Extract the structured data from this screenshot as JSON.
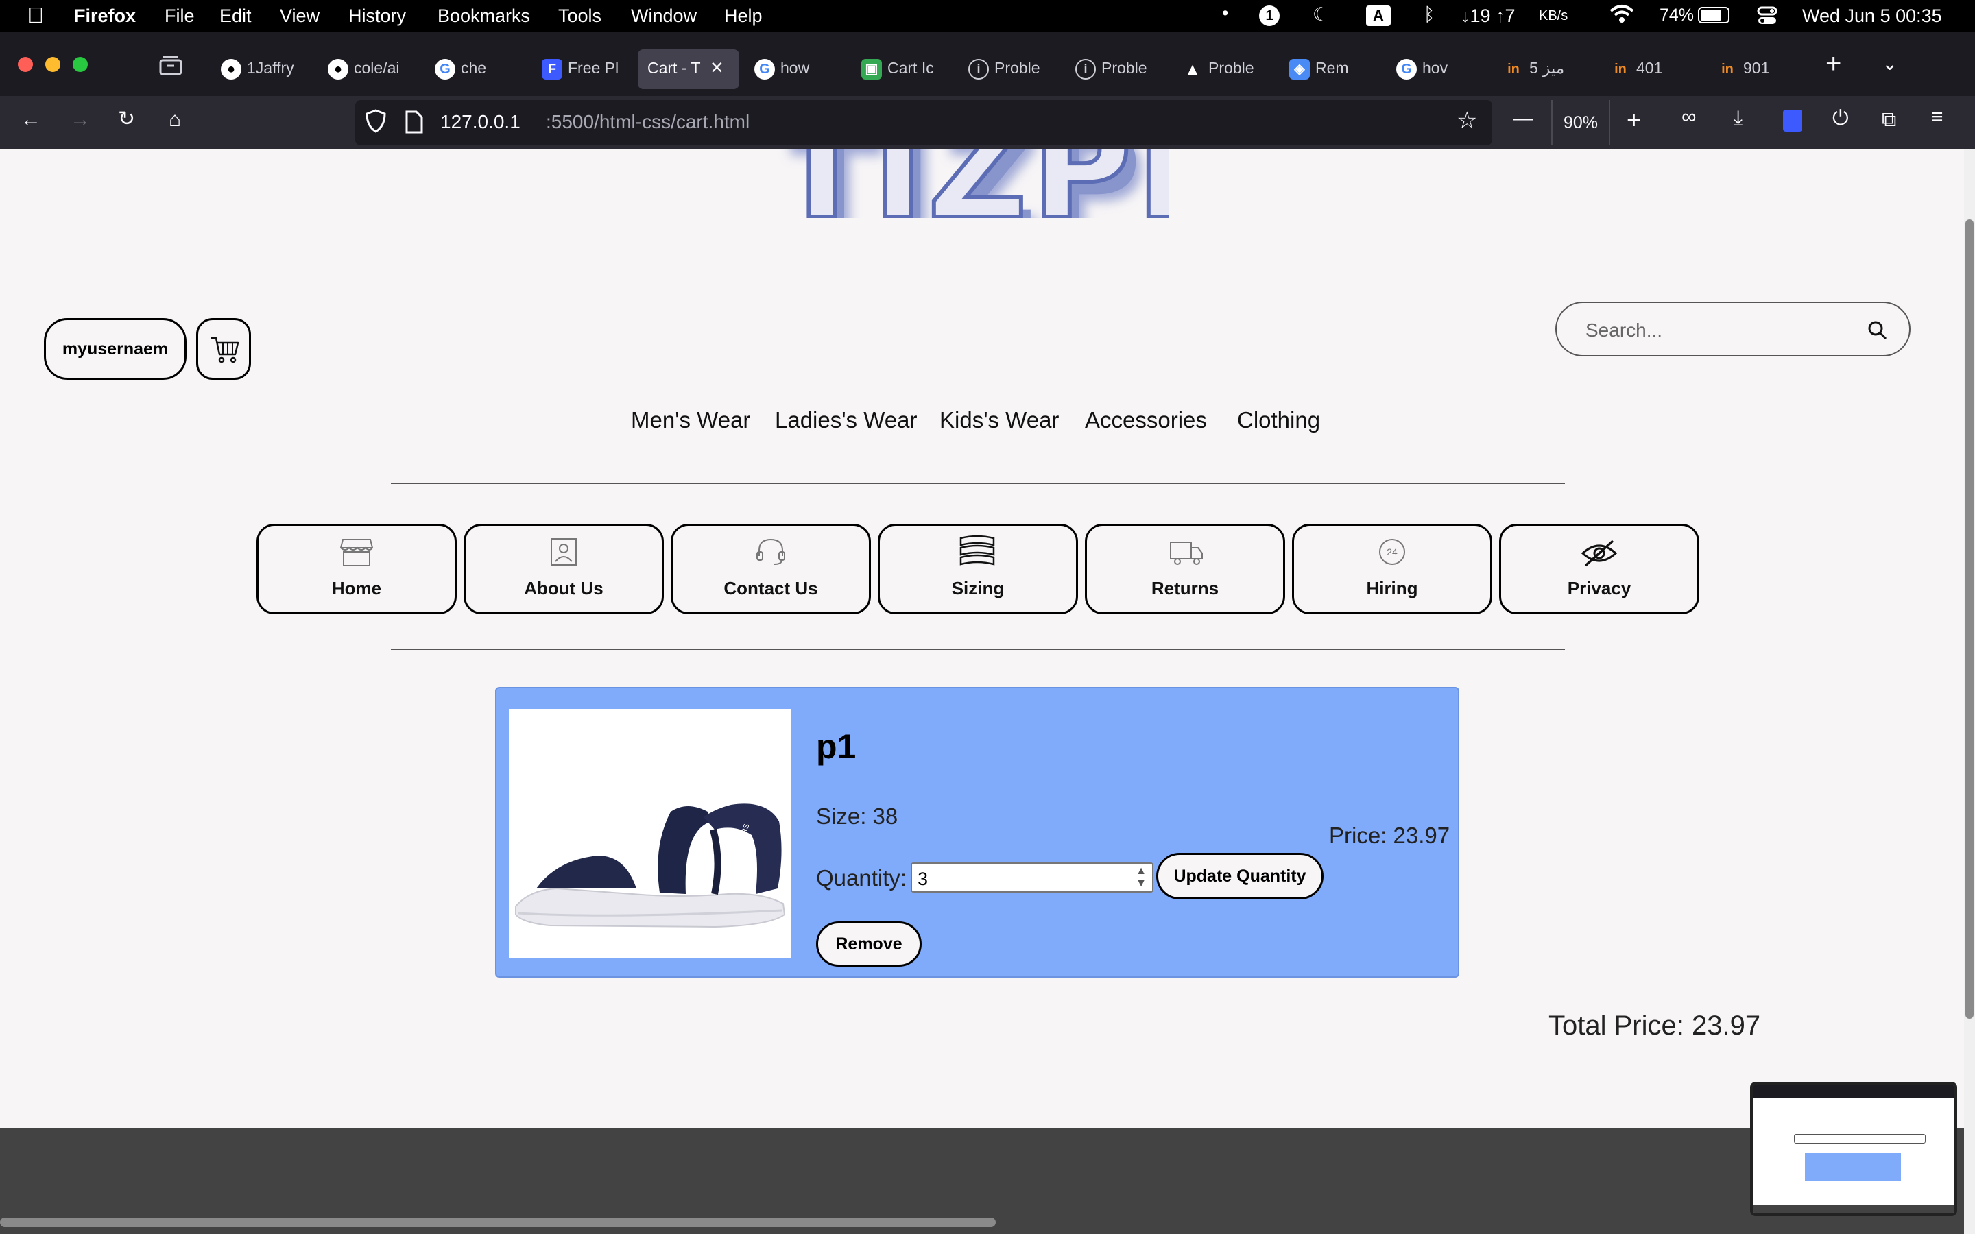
{
  "menubar": {
    "app": "Firefox",
    "items": [
      "File",
      "Edit",
      "View",
      "History",
      "Bookmarks",
      "Tools",
      "Window",
      "Help"
    ],
    "status": {
      "badge": "1",
      "input_source": "A",
      "network": "↓19 ↑7",
      "network_unit": "KB/s",
      "battery": "74%",
      "datetime": "Wed Jun 5  00:35"
    }
  },
  "tabs": [
    {
      "label": "1Jaffry",
      "icon": "github-icon"
    },
    {
      "label": "cole/ai",
      "icon": "github-icon"
    },
    {
      "label": "che",
      "icon": "google-icon"
    },
    {
      "label": "Free Pl",
      "icon": "f-icon"
    },
    {
      "label": "Cart - T",
      "icon": "",
      "active": true
    },
    {
      "label": "how",
      "icon": "google-icon"
    },
    {
      "label": "Cart Ic",
      "icon": "box-icon"
    },
    {
      "label": "Proble",
      "icon": "info-icon"
    },
    {
      "label": "Proble",
      "icon": "info-icon"
    },
    {
      "label": "Proble",
      "icon": "warning-icon"
    },
    {
      "label": "Rem",
      "icon": "shield-icon"
    },
    {
      "label": "hov",
      "icon": "google-icon"
    },
    {
      "label": "5 ميز",
      "icon": "in-icon"
    },
    {
      "label": "401",
      "icon": "in-icon"
    },
    {
      "label": "901",
      "icon": "in-icon"
    }
  ],
  "url": {
    "host": "127.0.0.1",
    "rest": ":5500/html-css/cart.html"
  },
  "zoom": "90%",
  "page": {
    "logo": "TIZPH",
    "username": "myusernaem",
    "search_placeholder": "Search...",
    "categories": [
      "Men's Wear",
      "Ladies's Wear",
      "Kids's Wear",
      "Accessories",
      "Clothing"
    ],
    "nav_buttons": [
      "Home",
      "About Us",
      "Contact Us",
      "Sizing",
      "Returns",
      "Hiring",
      "Privacy"
    ],
    "cart_item": {
      "name": "p1",
      "size": "Size: 38",
      "price": "Price: 23.97",
      "quantity_label": "Quantity:",
      "quantity": "3",
      "update_label": "Update Quantity",
      "remove_label": "Remove"
    },
    "total": "Total Price: 23.97"
  },
  "colors": {
    "cart_bg": "#80aafa",
    "footer": "#434343",
    "tab_bar": "#1c1b22"
  }
}
